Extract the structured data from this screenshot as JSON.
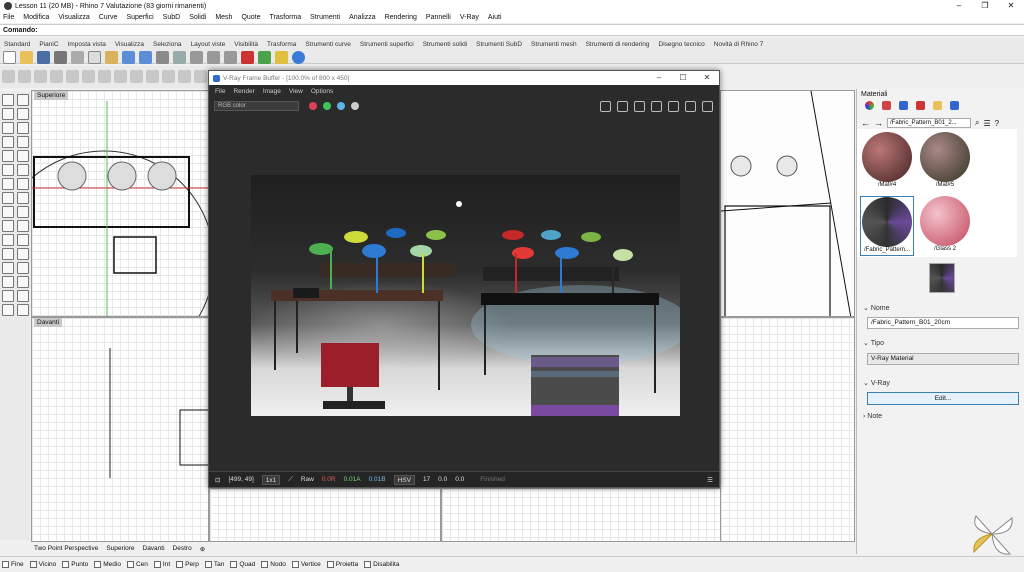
{
  "app": {
    "title": "Lesson 11 (20 MB) - Rhino 7 Valutazione (83 giorni rimanenti)"
  },
  "menu": [
    "File",
    "Modifica",
    "Visualizza",
    "Curve",
    "Superfici",
    "SubD",
    "Solidi",
    "Mesh",
    "Quote",
    "Trasforma",
    "Strumenti",
    "Analizza",
    "Rendering",
    "Pannelli",
    "V-Ray",
    "Aiuti"
  ],
  "command": {
    "label": "Comando:"
  },
  "tabs": [
    "Standard",
    "PianiC",
    "Imposta vista",
    "Visualizza",
    "Seleziona",
    "Layout viste",
    "Visibilità",
    "Trasforma",
    "Strumenti curve",
    "Strumenti superfici",
    "Strumenti solidi",
    "Strumenti SubD",
    "Strumenti mesh",
    "Strumenti di rendering",
    "Disegno tecnico",
    "Novità di Rhino 7"
  ],
  "viewports": {
    "top": "Superiore",
    "front": "Davanti"
  },
  "viewport_tabs": [
    "Two Point Perspective",
    "Superiore",
    "Davanti",
    "Destro"
  ],
  "snaps": [
    "Fine",
    "Vicino",
    "Punto",
    "Medio",
    "Cen",
    "Int",
    "Perp",
    "Tan",
    "Quad",
    "Nodo",
    "Vertice",
    "Proietta",
    "Disabilita"
  ],
  "vfb": {
    "title": "V-Ray Frame Buffer - [100.0% of 800 x 450]",
    "menu": [
      "File",
      "Render",
      "Image",
      "View",
      "Options"
    ],
    "channel": "RGB color",
    "dot_colors": [
      "#e0405a",
      "#3fc45a",
      "#5ab4e6"
    ],
    "status": {
      "coords": "[499, 49]",
      "zoom": "1x1",
      "mode": "Raw",
      "r": "0.0R",
      "g": "0.01A",
      "b": "0.01B",
      "cs": "HSV",
      "v1": "17",
      "v2": "0.0",
      "v3": "0.0",
      "state": "Finished"
    }
  },
  "panel": {
    "header": "Materiali",
    "breadcrumb": "/Fabric_Pattern_B01_2...",
    "thumbs": [
      "/Mat#4",
      "/Mat#5",
      "/Fabric_Pattern...",
      "/Glass 2",
      "",
      ""
    ],
    "name_label": "Nome",
    "name_value": "/Fabric_Pattern_B01_20cm",
    "type_label": "Tipo",
    "type_value": "V-Ray Material",
    "vray_label": "V-Ray",
    "edit_label": "Edit...",
    "note_label": "Note"
  }
}
